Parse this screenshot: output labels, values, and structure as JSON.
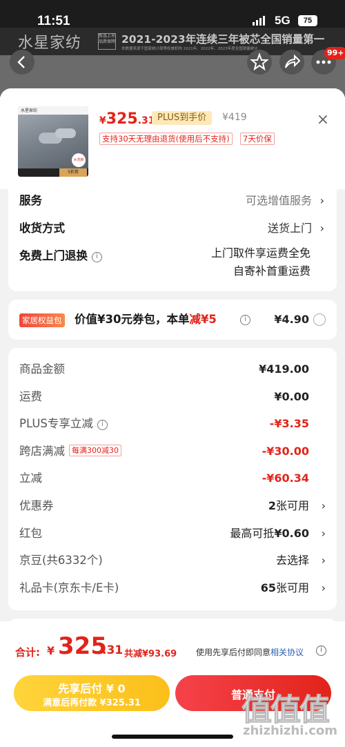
{
  "status": {
    "time": "11:51",
    "network": "5G",
    "battery": "75"
  },
  "banner": {
    "brand": "水星家纺",
    "tag": "新品上市 品质保障",
    "headline": "2021-2023年连续三年被芯全国销量第一",
    "fine": "本数据来源于国家统计局等权威机构 2021年、2022年、2023年度全国销量统计"
  },
  "nav": {
    "cart_badge": "99+"
  },
  "product": {
    "thumb_brand": "水星家纺",
    "thumb_sticker": "5折券",
    "thumb_stamp": "水洗棉",
    "price_symbol": "¥",
    "price_int": "325",
    "price_dec": ".31",
    "plus_tag": "PLUS到手价",
    "orig_price": "¥419",
    "return_tag": "支持30天无理由退货(使用后不支持)",
    "protect_tag": "7天价保",
    "close": "×"
  },
  "service": {
    "rows": [
      {
        "label": "服务",
        "value": "可选增值服务",
        "chev": "›"
      },
      {
        "label": "收货方式",
        "value": "送货上门",
        "chev": "›"
      },
      {
        "label": "免费上门退换",
        "info": "i"
      }
    ],
    "return_line1": "上门取件享运费全免",
    "return_line2": "自寄补首重运费"
  },
  "coupon": {
    "badge": "家居权益包",
    "text_pre": "价值¥30元券包，本单",
    "text_red": "减¥5",
    "info": "i",
    "price": "¥4.90"
  },
  "amounts": {
    "rows": [
      {
        "label": "商品金额",
        "value": "¥419.00"
      },
      {
        "label": "运费",
        "value": "¥0.00"
      },
      {
        "label": "PLUS专享立减",
        "value": "-¥3.35"
      },
      {
        "label": "跨店满减",
        "tag": "每满300减30",
        "value": "-¥30.00"
      },
      {
        "label": "立减",
        "value": "-¥60.34"
      },
      {
        "label": "优惠券",
        "value_bold": "2",
        "value_rest": "张可用"
      },
      {
        "label": "红包",
        "value_rest": "最高可抵",
        "value_bold": "¥0.60"
      },
      {
        "label": "京豆(共6332个)",
        "value": "去选择"
      },
      {
        "label": "礼品卡(京东卡/E卡)",
        "value_bold": "65",
        "value_rest": "张可用"
      }
    ],
    "chev": "›"
  },
  "footer": {
    "total_label": "合计:",
    "total_symbol": "¥",
    "total_int": "325",
    "total_dec": ".31",
    "total_save": "共减¥93.69",
    "agree_text": "使用先享后付即同意",
    "agree_link": "相关协议",
    "agree_icon": "i",
    "later_main": "先享后付 ¥ 0",
    "later_sub": "满意后再付款 ¥325.31",
    "pay_label": "普通支付"
  },
  "watermark": {
    "logo": "值值值",
    "url": "zhizhizhi.com"
  },
  "colors": {
    "accent_red": "#e2231a",
    "plus_gold": "#fde9b8",
    "later_yellow": "#ffd43b"
  }
}
